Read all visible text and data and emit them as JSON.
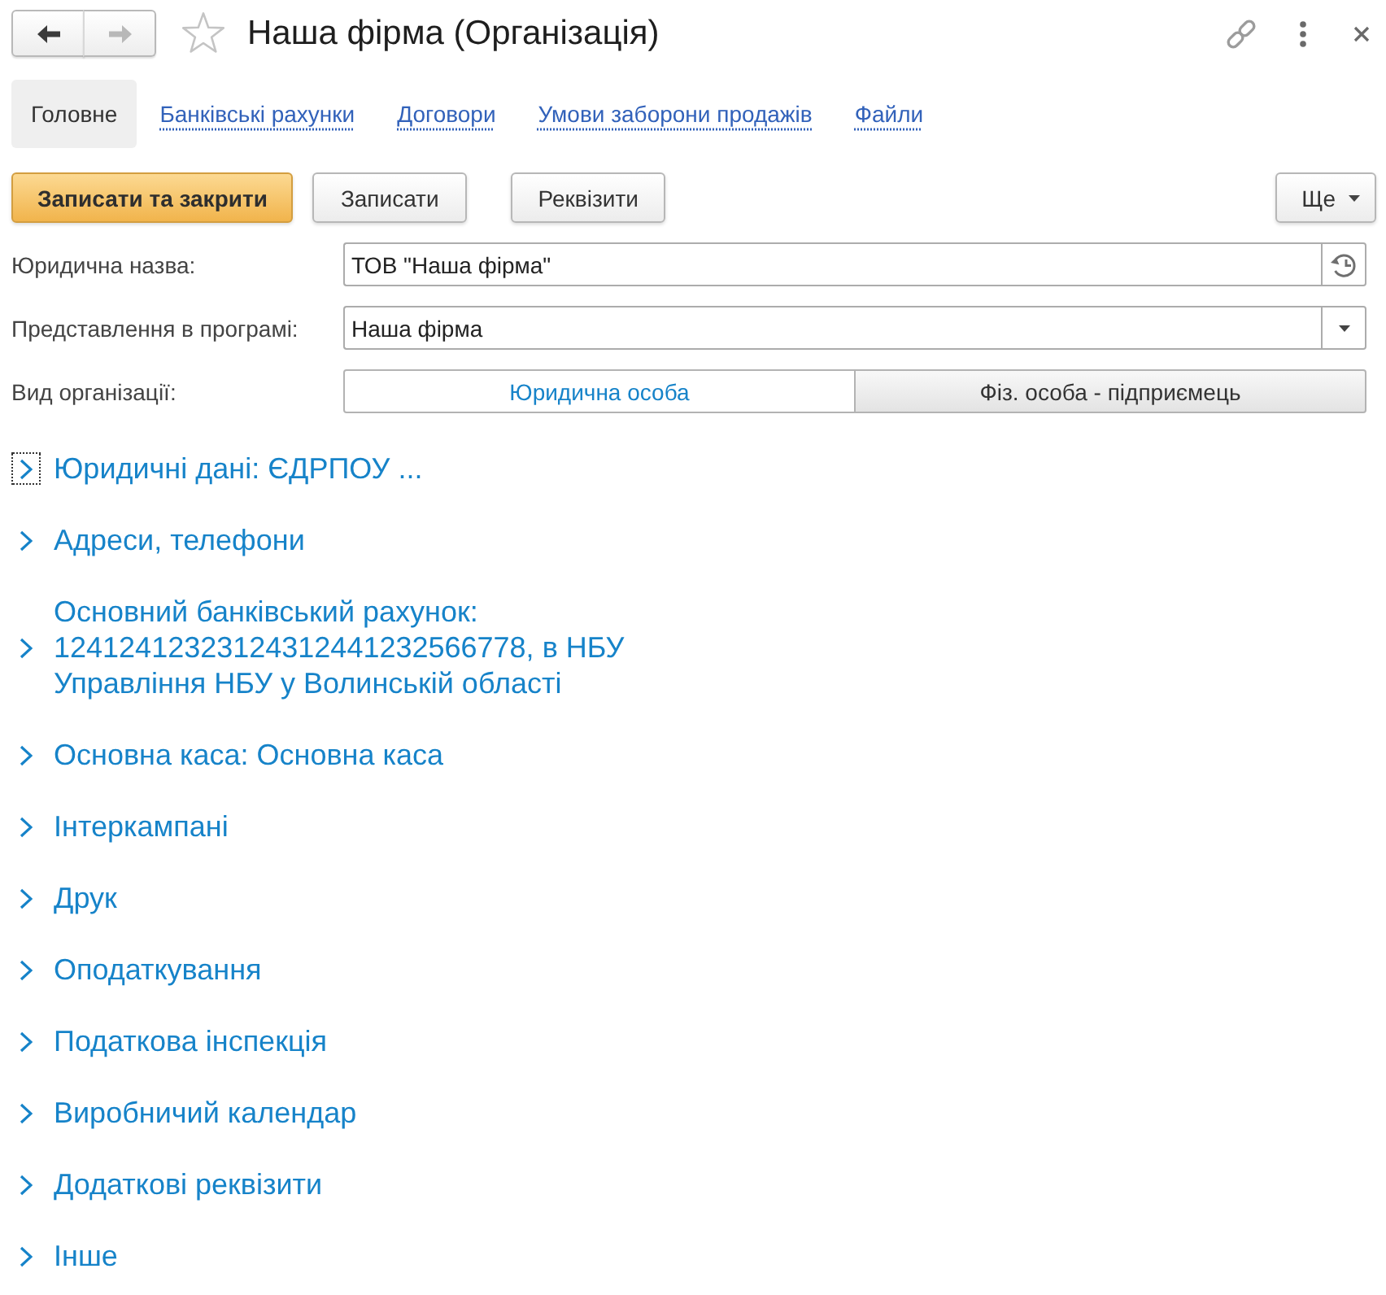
{
  "window": {
    "title": "Наша фірма (Організація)",
    "favorite": false
  },
  "navigation": [
    {
      "kind": "back",
      "disabled": false
    },
    {
      "kind": "forward",
      "disabled": true
    }
  ],
  "tabs": [
    {
      "label": "Головне",
      "selected": true
    },
    {
      "label": "Банківські рахунки",
      "selected": false
    },
    {
      "label": "Договори",
      "selected": false
    },
    {
      "label": "Умови заборони продажів",
      "selected": false
    },
    {
      "label": "Файли",
      "selected": false
    }
  ],
  "toolbar": {
    "buttons": [
      {
        "label": "Записати та закрити",
        "kind": "primary"
      },
      {
        "label": "Записати",
        "kind": "default"
      },
      {
        "label": "Реквізити",
        "kind": "default"
      }
    ],
    "more": {
      "label": "Ще"
    }
  },
  "fields": [
    {
      "label": "Юридична назва:",
      "kind": "history",
      "value": "ТОВ \"Наша фірма\""
    },
    {
      "label": "Представлення в програмі:",
      "kind": "dropdown",
      "value": "Наша фірма"
    },
    {
      "label": "Вид організації:",
      "kind": "radio",
      "options": [
        {
          "label": "Юридична особа",
          "selected": true
        },
        {
          "label": "Фіз. особа - підприємець",
          "selected": false
        }
      ]
    }
  ],
  "groups": [
    {
      "title": "Юридичні дані: ЄДРПОУ ...",
      "expanded": false,
      "focused": true
    },
    {
      "title": "Адреси, телефони",
      "expanded": false,
      "focused": false
    },
    {
      "title": "Основний банківський рахунок: 12412412323124312441232566778, в НБУ Управління НБУ у Волинській області",
      "expanded": false,
      "focused": false
    },
    {
      "title": "Основна каса: Основна каса",
      "expanded": false,
      "focused": false
    },
    {
      "title": "Інтеркампані",
      "expanded": false,
      "focused": false
    },
    {
      "title": "Друк",
      "expanded": false,
      "focused": false
    },
    {
      "title": "Оподаткування",
      "expanded": false,
      "focused": false
    },
    {
      "title": "Податкова інспекція",
      "expanded": false,
      "focused": false
    },
    {
      "title": "Виробничий календар",
      "expanded": false,
      "focused": false
    },
    {
      "title": "Додаткові реквізити",
      "expanded": false,
      "focused": false
    },
    {
      "title": "Інше",
      "expanded": false,
      "focused": false
    }
  ]
}
